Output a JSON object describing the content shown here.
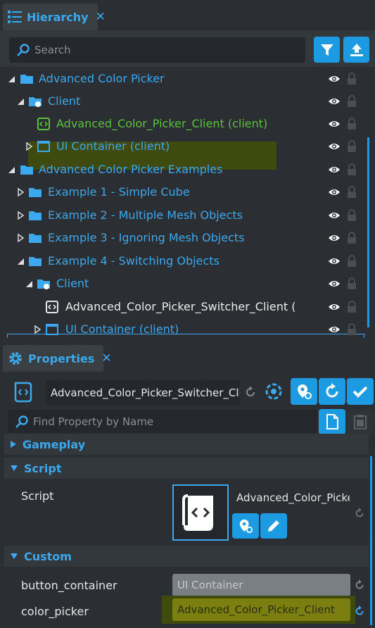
{
  "hierarchy": {
    "tab_title": "Hierarchy",
    "close_glyph": "✕",
    "search_placeholder": "Search",
    "items": [
      {
        "label": "Advanced Color Picker",
        "icon": "folder-icon",
        "expanded": true
      },
      {
        "label": "Client",
        "icon": "client-folder-icon",
        "expanded": true
      },
      {
        "label": "Advanced_Color_Picker_Client (client)",
        "icon": "script-icon"
      },
      {
        "label": "UI Container (client)",
        "icon": "ui-container-icon",
        "expanded": false
      },
      {
        "label": "Advanced Color Picker Examples",
        "icon": "folder-icon",
        "expanded": true
      },
      {
        "label": "Example 1 - Simple Cube",
        "icon": "folder-icon",
        "expanded": false
      },
      {
        "label": "Example 2 - Multiple Mesh Objects",
        "icon": "folder-icon",
        "expanded": false
      },
      {
        "label": "Example 3 - Ignoring Mesh Objects",
        "icon": "folder-icon",
        "expanded": false
      },
      {
        "label": "Example 4 - Switching Objects",
        "icon": "folder-icon",
        "expanded": true
      },
      {
        "label": "Client",
        "icon": "client-folder-icon",
        "expanded": true
      },
      {
        "label": "Advanced_Color_Picker_Switcher_Client (c",
        "icon": "script-icon"
      },
      {
        "label": "UI Container (client)",
        "icon": "ui-container-icon",
        "expanded": false
      }
    ]
  },
  "properties": {
    "tab_title": "Properties",
    "close_glyph": "✕",
    "object_name": "Advanced_Color_Picker_Switcher_Clie",
    "find_placeholder": "Find Property by Name",
    "sections": {
      "gameplay": "Gameplay",
      "script": "Script",
      "custom": "Custom"
    },
    "script_label": "Script",
    "script_value": "Advanced_Color_Picke",
    "button_container_label": "button_container",
    "button_container_value": "UI Container",
    "color_picker_label": "color_picker",
    "color_picker_value": "Advanced_Color_Picker_Client"
  },
  "colors": {
    "accent": "#3ca8f0",
    "button_blue": "#1c9be3",
    "highlight_green": "#3e4a0e",
    "selected_text_green": "#5bc23a",
    "field_yellow": "#7a7f10"
  }
}
